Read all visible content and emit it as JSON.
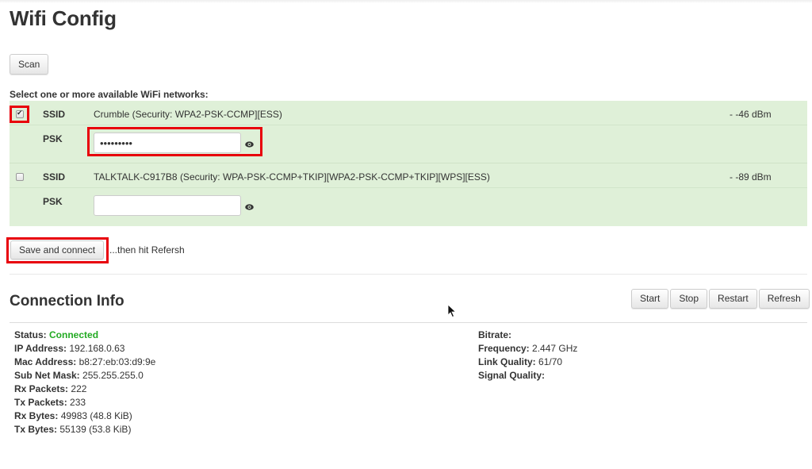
{
  "page": {
    "title": "Wifi Config"
  },
  "scan": {
    "label": "Scan"
  },
  "networks": {
    "prompt": "Select one or more available WiFi networks:",
    "ssid_label": "SSID",
    "psk_label": "PSK",
    "items": [
      {
        "checked": true,
        "ssid": "Crumble (Security: WPA2-PSK-CCMP][ESS)",
        "signal": "- -46 dBm",
        "psk_value": "•••••••••",
        "show_icon": "eye-icon"
      },
      {
        "checked": false,
        "ssid": "TALKTALK-C917B8 (Security: WPA-PSK-CCMP+TKIP][WPA2-PSK-CCMP+TKIP][WPS][ESS)",
        "signal": "- -89 dBm",
        "psk_value": "",
        "show_icon": "eye-icon"
      }
    ]
  },
  "save": {
    "label": "Save and connect",
    "hint": "...then hit Refersh"
  },
  "connection": {
    "title": "Connection Info",
    "buttons": {
      "start": "Start",
      "stop": "Stop",
      "restart": "Restart",
      "refresh": "Refresh"
    },
    "left": [
      {
        "key": "Status:",
        "value": "Connected"
      },
      {
        "key": "IP Address:",
        "value": "192.168.0.63"
      },
      {
        "key": "Mac Address:",
        "value": "b8:27:eb:03:d9:9e"
      },
      {
        "key": "Sub Net Mask:",
        "value": "255.255.255.0"
      },
      {
        "key": "Rx Packets:",
        "value": "222"
      },
      {
        "key": "Tx Packets:",
        "value": "233"
      },
      {
        "key": "Rx Bytes:",
        "value": "49983 (48.8 KiB)"
      },
      {
        "key": "Tx Bytes:",
        "value": "55139 (53.8 KiB)"
      }
    ],
    "right": [
      {
        "key": "Bitrate:",
        "value": ""
      },
      {
        "key": "Frequency:",
        "value": "2.447 GHz"
      },
      {
        "key": "Link Quality:",
        "value": "61/70"
      },
      {
        "key": "Signal Quality:",
        "value": ""
      }
    ]
  },
  "colors": {
    "network_bg": "#dff0d8",
    "highlight": "#e8000b",
    "status_ok": "#22aa22"
  }
}
